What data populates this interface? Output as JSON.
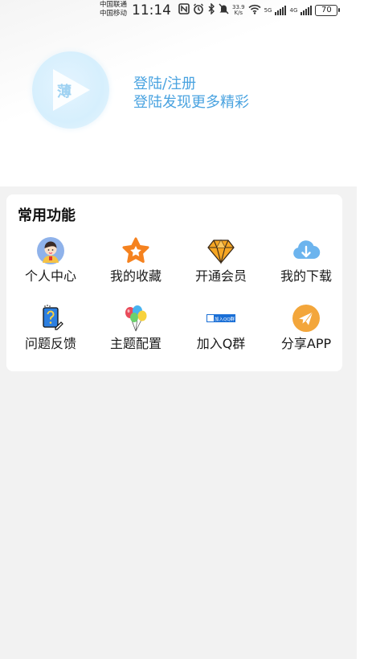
{
  "status_bar": {
    "carrier_1": "中国联通",
    "carrier_2": "中国移动",
    "time": "11:14",
    "speed_value": "33.9",
    "speed_unit": "K/s",
    "net_5g": "5G",
    "net_4g": "4G",
    "battery": "70"
  },
  "profile": {
    "login_label": "登陆/注册",
    "login_hint": "登陆发现更多精彩",
    "avatar_glyph": "薄"
  },
  "functions": {
    "title": "常用功能",
    "items": [
      {
        "label": "个人中心",
        "icon": "user-avatar-icon"
      },
      {
        "label": "我的收藏",
        "icon": "star-icon"
      },
      {
        "label": "开通会员",
        "icon": "diamond-icon"
      },
      {
        "label": "我的下载",
        "icon": "cloud-download-icon"
      },
      {
        "label": "问题反馈",
        "icon": "feedback-icon"
      },
      {
        "label": "主题配置",
        "icon": "balloons-icon"
      },
      {
        "label": "加入Q群",
        "icon": "join-qq-group-icon"
      },
      {
        "label": "分享APP",
        "icon": "share-plane-icon"
      }
    ],
    "qq_badge_text": "加入QQ群"
  },
  "colors": {
    "accent": "#4aa3e0",
    "star": "#f5821f",
    "diamond": "#f6a623",
    "cloud": "#6cb4ee",
    "share": "#f3a63b"
  }
}
